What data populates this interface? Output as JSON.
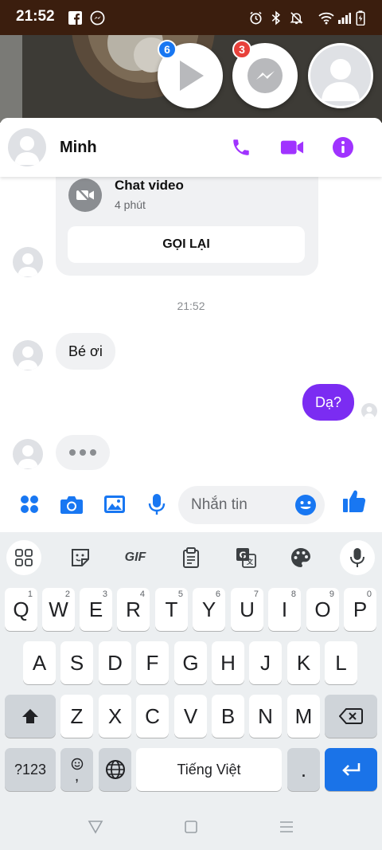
{
  "status_bar": {
    "time": "21:52"
  },
  "chat_heads": [
    {
      "name": "video",
      "badge": "6",
      "badge_color": "#1877f2"
    },
    {
      "name": "messenger",
      "badge": "3",
      "badge_color": "#e8413b"
    },
    {
      "name": "contact",
      "badge": "",
      "badge_color": ""
    }
  ],
  "header": {
    "name": "Minh"
  },
  "call_card": {
    "title": "Chat video",
    "duration": "4 phút",
    "button": "GỌI LẠI"
  },
  "timestamp": "21:52",
  "messages": [
    {
      "from": "them",
      "text": "Bé ơi"
    },
    {
      "from": "me",
      "text": "Dạ?"
    }
  ],
  "composer": {
    "placeholder": "Nhắn tin"
  },
  "keyboard": {
    "toolbar": [
      "apps-grid",
      "sticker",
      "GIF",
      "clipboard",
      "translate",
      "palette",
      "mic"
    ],
    "gif_label": "GIF",
    "row1": [
      {
        "key": "Q",
        "hint": "1"
      },
      {
        "key": "W",
        "hint": "2"
      },
      {
        "key": "E",
        "hint": "3"
      },
      {
        "key": "R",
        "hint": "4"
      },
      {
        "key": "T",
        "hint": "5"
      },
      {
        "key": "Y",
        "hint": "6"
      },
      {
        "key": "U",
        "hint": "7"
      },
      {
        "key": "I",
        "hint": "8"
      },
      {
        "key": "O",
        "hint": "9"
      },
      {
        "key": "P",
        "hint": "0"
      }
    ],
    "row2": [
      "A",
      "S",
      "D",
      "F",
      "G",
      "H",
      "J",
      "K",
      "L"
    ],
    "row3": [
      "Z",
      "X",
      "C",
      "V",
      "B",
      "N",
      "M"
    ],
    "numbers_key": "?123",
    "emoji_comma_key": ",",
    "space_label": "Tiếng Việt",
    "period_key": "."
  },
  "colors": {
    "accent": "#a033ff",
    "brand_blue": "#1877f2",
    "outgoing": "#7b2cf2",
    "enter": "#1a73e8"
  }
}
